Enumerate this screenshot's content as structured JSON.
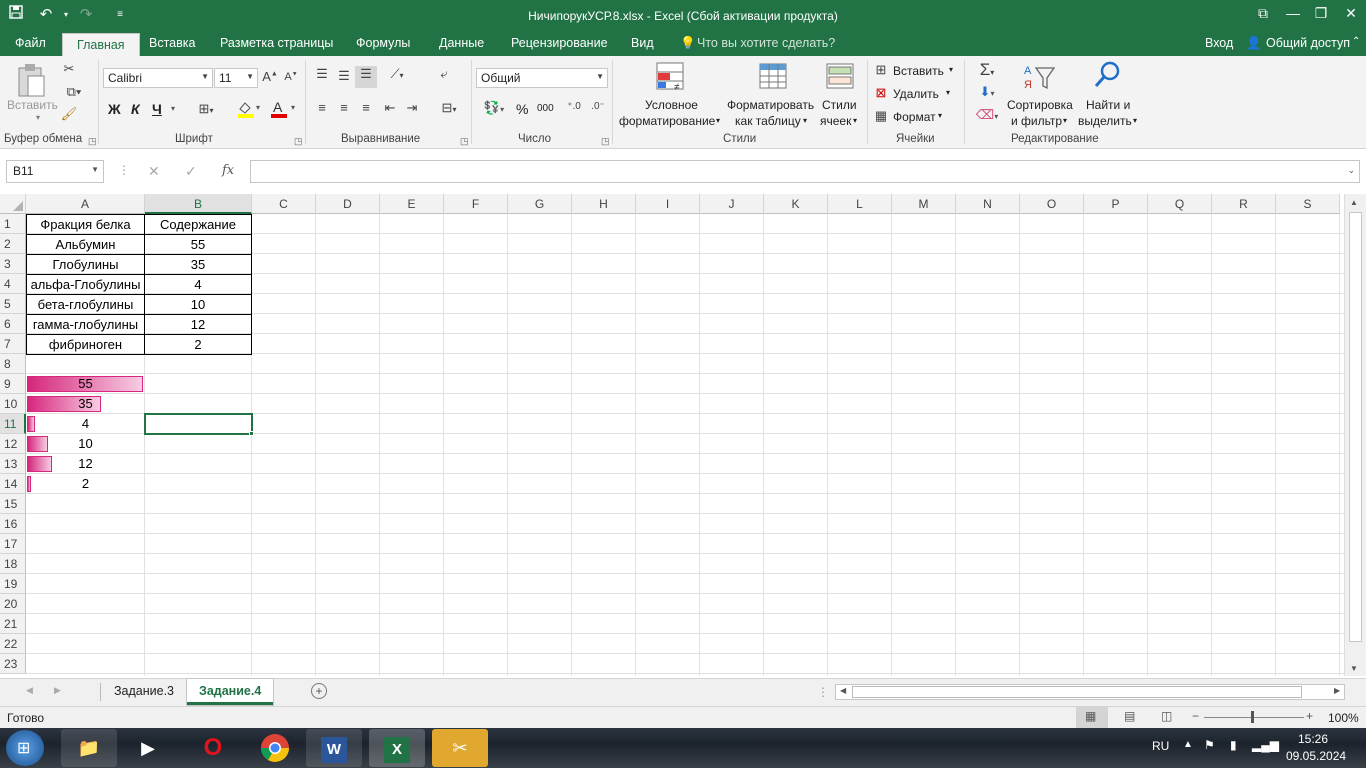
{
  "window": {
    "title": "НичипорукУСР.8.xlsx - Excel (Сбой активации продукта)"
  },
  "tabs": {
    "file": "Файл",
    "home": "Главная",
    "insert": "Вставка",
    "layout": "Разметка страницы",
    "formulas": "Формулы",
    "data": "Данные",
    "review": "Рецензирование",
    "view": "Вид",
    "tellme": "Что вы хотите сделать?",
    "signin": "Вход",
    "share": "Общий доступ"
  },
  "ribbon": {
    "clipboard": {
      "label": "Буфер обмена",
      "paste": "Вставить"
    },
    "font": {
      "label": "Шрифт",
      "name": "Calibri",
      "size": "11",
      "bold": "Ж",
      "italic": "К",
      "underline": "Ч"
    },
    "alignment": {
      "label": "Выравнивание"
    },
    "number": {
      "label": "Число",
      "format": "Общий",
      "percent": "%",
      "thousands": "000"
    },
    "styles": {
      "label": "Стили",
      "cond1": "Условное",
      "cond2": "форматирование",
      "table1": "Форматировать",
      "table2": "как таблицу",
      "cell1": "Стили",
      "cell2": "ячеек"
    },
    "cells": {
      "label": "Ячейки",
      "insert": "Вставить",
      "delete": "Удалить",
      "format": "Формат"
    },
    "editing": {
      "label": "Редактирование",
      "sort1": "Сортировка",
      "sort2": "и фильтр",
      "find1": "Найти и",
      "find2": "выделить"
    }
  },
  "formula_bar": {
    "name_box": "B11",
    "fx": "fx",
    "value": ""
  },
  "columns": [
    "A",
    "B",
    "C",
    "D",
    "E",
    "F",
    "G",
    "H",
    "I",
    "J",
    "K",
    "L",
    "M",
    "N",
    "O",
    "P",
    "Q",
    "R",
    "S"
  ],
  "rows": [
    "1",
    "2",
    "3",
    "4",
    "5",
    "6",
    "7",
    "8",
    "9",
    "10",
    "11",
    "12",
    "13",
    "14",
    "15",
    "16",
    "17",
    "18",
    "19",
    "20",
    "21",
    "22",
    "23"
  ],
  "table": {
    "header": [
      "Фракция белка",
      "Содержание"
    ],
    "rows": [
      [
        "Альбумин",
        "55"
      ],
      [
        "Глобулины",
        "35"
      ],
      [
        "альфа-Глобулины",
        "4"
      ],
      [
        "бета-глобулины",
        "10"
      ],
      [
        "гамма-глобулины",
        "12"
      ],
      [
        "фибриноген",
        "2"
      ]
    ]
  },
  "databars": {
    "max": 55,
    "values": [
      "55",
      "35",
      "4",
      "10",
      "12",
      "2"
    ],
    "color": "#d6267d"
  },
  "selected_cell": "B11",
  "sheets": [
    "Задание.3",
    "Задание.4"
  ],
  "active_sheet": "Задание.4",
  "status": {
    "ready": "Готово",
    "zoom": "100%"
  },
  "taskbar": {
    "lang": "RU",
    "time": "15:26",
    "date": "09.05.2024"
  },
  "colors": {
    "accent": "#217346",
    "databar": "#d6267d"
  }
}
